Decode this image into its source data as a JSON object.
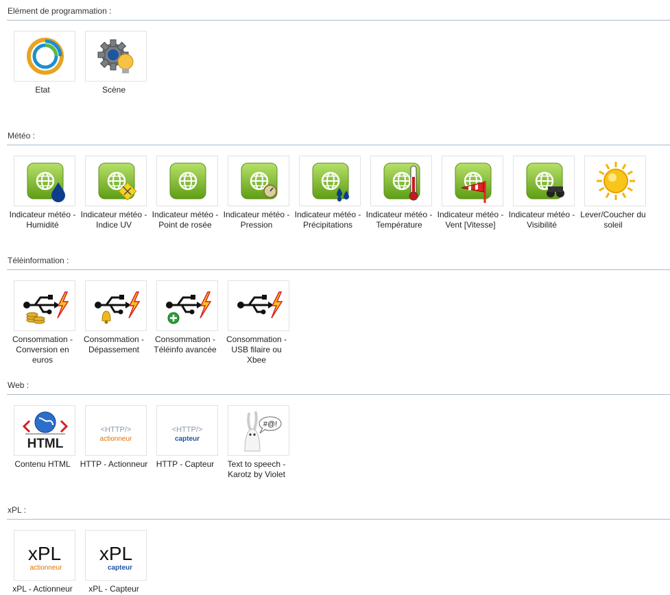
{
  "sections": [
    {
      "title": "Elément de programmation :",
      "items": [
        {
          "label": "Etat",
          "icon": "status-ring-icon"
        },
        {
          "label": "Scène",
          "icon": "gear-bulb-icon"
        }
      ]
    },
    {
      "title": "Météo :",
      "items": [
        {
          "label": "Indicateur météo - Humidité",
          "icon": "weather-humidity-icon"
        },
        {
          "label": "Indicateur météo - Indice UV",
          "icon": "weather-uv-icon"
        },
        {
          "label": "Indicateur météo - Point de rosée",
          "icon": "weather-dewpoint-icon"
        },
        {
          "label": "Indicateur météo - Pression",
          "icon": "weather-pressure-icon"
        },
        {
          "label": "Indicateur météo - Précipitations",
          "icon": "weather-precipitation-icon"
        },
        {
          "label": "Indicateur météo - Température",
          "icon": "weather-temperature-icon"
        },
        {
          "label": "Indicateur météo - Vent [Vitesse]",
          "icon": "weather-wind-icon"
        },
        {
          "label": "Indicateur météo - Visibilité",
          "icon": "weather-visibility-icon"
        },
        {
          "label": "Lever/Coucher du soleil",
          "icon": "sun-icon"
        }
      ]
    },
    {
      "title": "Téléinformation :",
      "items": [
        {
          "label": "Consommation - Conversion en euros",
          "icon": "usb-coins-icon"
        },
        {
          "label": "Consommation - Dépassement",
          "icon": "usb-bell-icon"
        },
        {
          "label": "Consommation - Téléinfo avancée",
          "icon": "usb-plus-icon"
        },
        {
          "label": "Consommation - USB filaire ou Xbee",
          "icon": "usb-lightning-icon"
        }
      ]
    },
    {
      "title": "Web :",
      "items": [
        {
          "label": "Contenu HTML",
          "icon": "html-globe-icon",
          "text": "HTML"
        },
        {
          "label": "HTTP - Actionneur",
          "icon": "http-actuator-icon",
          "text": "<HTTP/>",
          "sub": "actionneur"
        },
        {
          "label": "HTTP - Capteur",
          "icon": "http-sensor-icon",
          "text": "<HTTP/>",
          "sub": "capteur"
        },
        {
          "label": "Text to speech - Karotz by Violet",
          "icon": "karotz-rabbit-icon",
          "text": "#@!"
        }
      ]
    },
    {
      "title": "xPL :",
      "items": [
        {
          "label": "xPL - Actionneur",
          "icon": "xpl-actuator-icon",
          "text": "xPL",
          "sub": "actionneur"
        },
        {
          "label": "xPL - Capteur",
          "icon": "xpl-sensor-icon",
          "text": "xPL",
          "sub": "capteur"
        }
      ]
    }
  ],
  "colors": {
    "rule": "#a9bccd",
    "weather_green": "#7ab82a",
    "actuator_orange": "#e07000",
    "sensor_blue": "#1e55a0"
  }
}
